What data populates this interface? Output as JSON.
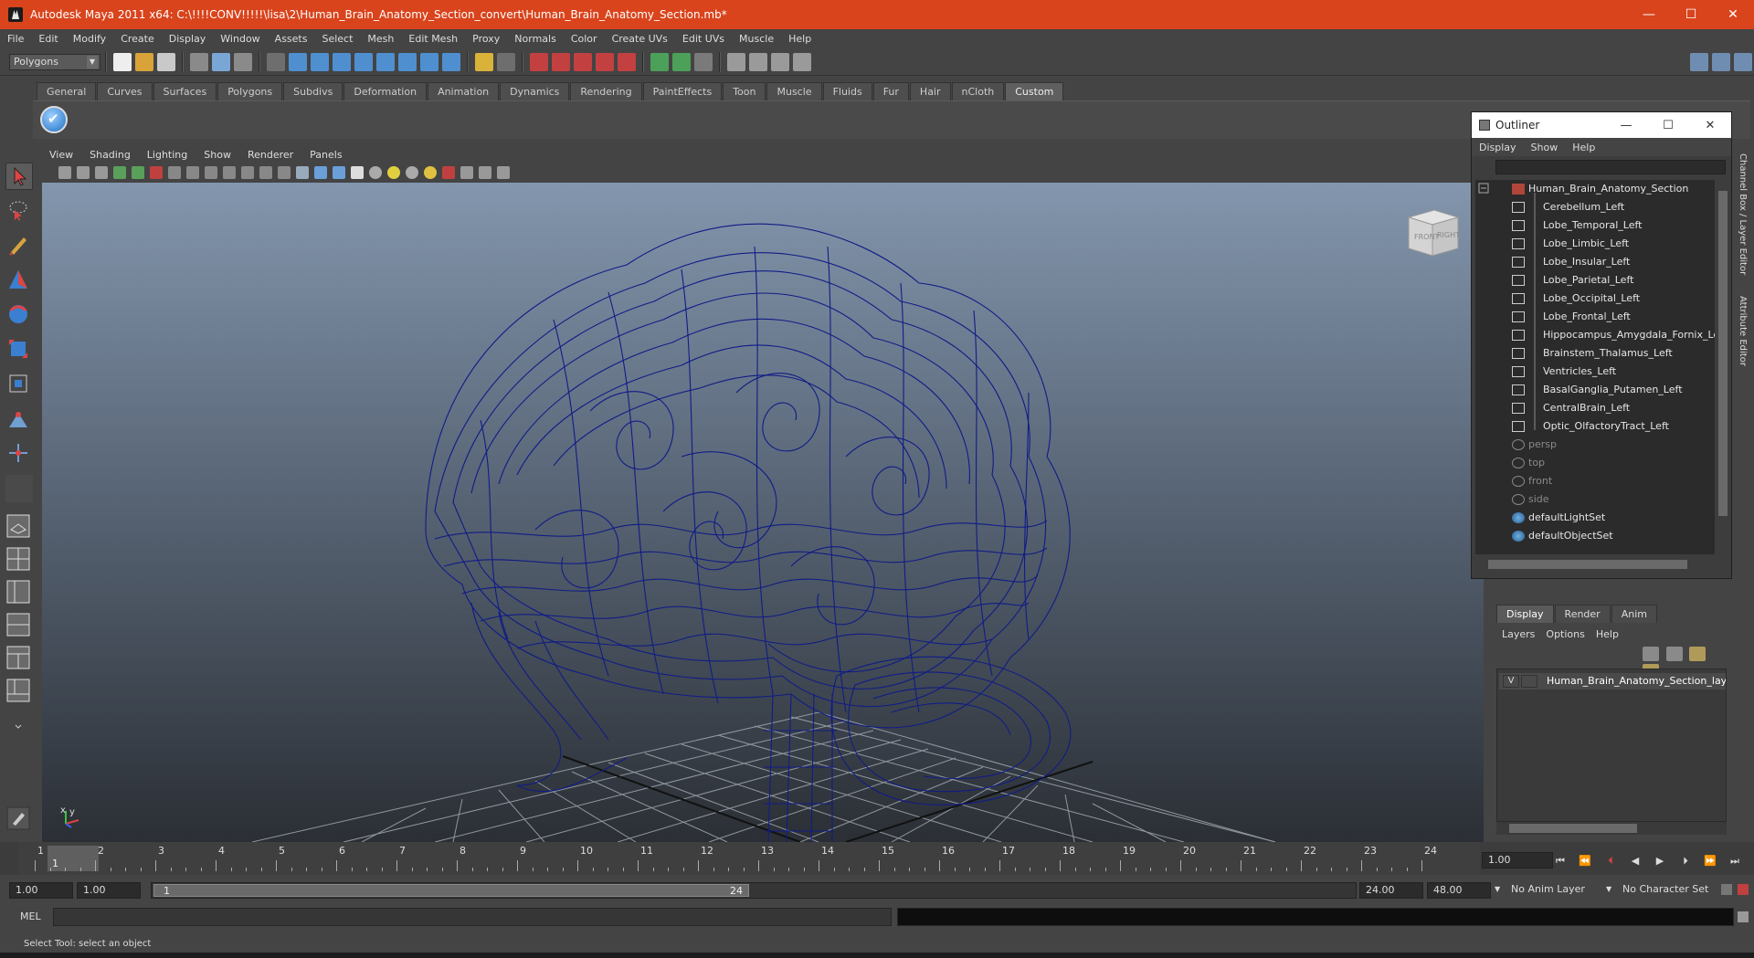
{
  "window": {
    "title": "Autodesk Maya 2011 x64: C:\\!!!!CONV!!!!!\\lisa\\2\\Human_Brain_Anatomy_Section_convert\\Human_Brain_Anatomy_Section.mb*",
    "minimize": "—",
    "maximize": "☐",
    "close": "✕"
  },
  "menubar": [
    "File",
    "Edit",
    "Modify",
    "Create",
    "Display",
    "Window",
    "Assets",
    "Select",
    "Mesh",
    "Edit Mesh",
    "Proxy",
    "Normals",
    "Color",
    "Create UVs",
    "Edit UVs",
    "Muscle",
    "Help"
  ],
  "statusline": {
    "mode": "Polygons"
  },
  "shelf": {
    "tabs": [
      "General",
      "Curves",
      "Surfaces",
      "Polygons",
      "Subdivs",
      "Deformation",
      "Animation",
      "Dynamics",
      "Rendering",
      "PaintEffects",
      "Toon",
      "Muscle",
      "Fluids",
      "Fur",
      "Hair",
      "nCloth",
      "Custom"
    ],
    "active": "Custom"
  },
  "viewport": {
    "menu": [
      "View",
      "Shading",
      "Lighting",
      "Show",
      "Renderer",
      "Panels"
    ],
    "viewcube": {
      "front": "FRONT",
      "right": "RIGHT"
    },
    "axis": {
      "x": "x",
      "y": "y"
    }
  },
  "outliner": {
    "title": "Outliner",
    "menu": [
      "Display",
      "Show",
      "Help"
    ],
    "root": "Human_Brain_Anatomy_Section",
    "children": [
      "Cerebellum_Left",
      "Lobe_Temporal_Left",
      "Lobe_Limbic_Left",
      "Lobe_Insular_Left",
      "Lobe_Parietal_Left",
      "Lobe_Occipital_Left",
      "Lobe_Frontal_Left",
      "Hippocampus_Amygdala_Fornix_Left",
      "Brainstem_Thalamus_Left",
      "Ventricles_Left",
      "BasalGanglia_Putamen_Left",
      "CentralBrain_Left",
      "Optic_OlfactoryTract_Left"
    ],
    "cameras": [
      "persp",
      "top",
      "front",
      "side"
    ],
    "sets": [
      "defaultLightSet",
      "defaultObjectSet"
    ]
  },
  "side_tabs": {
    "channel_box": "Channel Box / Layer Editor",
    "attribute_editor": "Attribute Editor"
  },
  "layer_editor": {
    "tabs": [
      "Display",
      "Render",
      "Anim"
    ],
    "active": "Display",
    "menu": [
      "Layers",
      "Options",
      "Help"
    ],
    "layer": {
      "visible": "V",
      "name": "Human_Brain_Anatomy_Section_layer"
    }
  },
  "timeline": {
    "ticks": [
      "1",
      "2",
      "3",
      "4",
      "5",
      "6",
      "7",
      "8",
      "9",
      "10",
      "11",
      "12",
      "13",
      "14",
      "15",
      "16",
      "17",
      "18",
      "19",
      "20",
      "21",
      "22",
      "23",
      "24"
    ],
    "current_frame": "1",
    "current_time_field": "1.00"
  },
  "range": {
    "start": "1.00",
    "anim_start": "1.00",
    "range_start": "1",
    "range_end": "24",
    "end": "24.00",
    "anim_end": "48.00",
    "anim_layer": "No Anim Layer",
    "character_set": "No Character Set"
  },
  "cmdline": {
    "label": "MEL"
  },
  "helpline": {
    "text": "Select Tool: select an object"
  },
  "colors": {
    "title_bar": "#d9441c",
    "wireframe": "#0d1a7a",
    "panel": "#444444"
  }
}
